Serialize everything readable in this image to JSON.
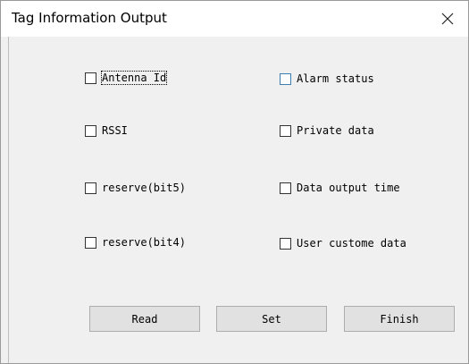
{
  "window": {
    "title": "Tag Information Output",
    "close_glyph": "✕"
  },
  "options": {
    "antenna_id": "Antenna Id",
    "alarm_status": "Alarm status",
    "rssi": "RSSI",
    "private_data": "Private data",
    "reserve_bit5": "reserve(bit5)",
    "data_output_time": "Data output time",
    "reserve_bit4": "reserve(bit4)",
    "user_custome_data": "User custome data"
  },
  "buttons": {
    "read": "Read",
    "set": "Set",
    "finish": "Finish"
  },
  "colors": {
    "focus_box": "#3c7fb1",
    "button_bg": "#e1e1e1"
  }
}
